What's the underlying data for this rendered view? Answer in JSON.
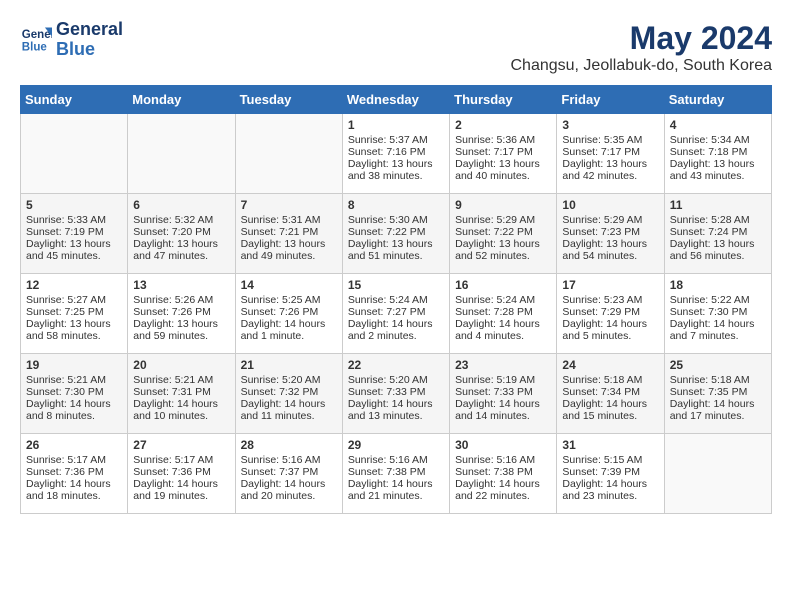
{
  "logo": {
    "line1": "General",
    "line2": "Blue"
  },
  "title": "May 2024",
  "location": "Changsu, Jeollabuk-do, South Korea",
  "days_of_week": [
    "Sunday",
    "Monday",
    "Tuesday",
    "Wednesday",
    "Thursday",
    "Friday",
    "Saturday"
  ],
  "weeks": [
    [
      {
        "day": "",
        "content": ""
      },
      {
        "day": "",
        "content": ""
      },
      {
        "day": "",
        "content": ""
      },
      {
        "day": "1",
        "content": "Sunrise: 5:37 AM\nSunset: 7:16 PM\nDaylight: 13 hours\nand 38 minutes."
      },
      {
        "day": "2",
        "content": "Sunrise: 5:36 AM\nSunset: 7:17 PM\nDaylight: 13 hours\nand 40 minutes."
      },
      {
        "day": "3",
        "content": "Sunrise: 5:35 AM\nSunset: 7:17 PM\nDaylight: 13 hours\nand 42 minutes."
      },
      {
        "day": "4",
        "content": "Sunrise: 5:34 AM\nSunset: 7:18 PM\nDaylight: 13 hours\nand 43 minutes."
      }
    ],
    [
      {
        "day": "5",
        "content": "Sunrise: 5:33 AM\nSunset: 7:19 PM\nDaylight: 13 hours\nand 45 minutes."
      },
      {
        "day": "6",
        "content": "Sunrise: 5:32 AM\nSunset: 7:20 PM\nDaylight: 13 hours\nand 47 minutes."
      },
      {
        "day": "7",
        "content": "Sunrise: 5:31 AM\nSunset: 7:21 PM\nDaylight: 13 hours\nand 49 minutes."
      },
      {
        "day": "8",
        "content": "Sunrise: 5:30 AM\nSunset: 7:22 PM\nDaylight: 13 hours\nand 51 minutes."
      },
      {
        "day": "9",
        "content": "Sunrise: 5:29 AM\nSunset: 7:22 PM\nDaylight: 13 hours\nand 52 minutes."
      },
      {
        "day": "10",
        "content": "Sunrise: 5:29 AM\nSunset: 7:23 PM\nDaylight: 13 hours\nand 54 minutes."
      },
      {
        "day": "11",
        "content": "Sunrise: 5:28 AM\nSunset: 7:24 PM\nDaylight: 13 hours\nand 56 minutes."
      }
    ],
    [
      {
        "day": "12",
        "content": "Sunrise: 5:27 AM\nSunset: 7:25 PM\nDaylight: 13 hours\nand 58 minutes."
      },
      {
        "day": "13",
        "content": "Sunrise: 5:26 AM\nSunset: 7:26 PM\nDaylight: 13 hours\nand 59 minutes."
      },
      {
        "day": "14",
        "content": "Sunrise: 5:25 AM\nSunset: 7:26 PM\nDaylight: 14 hours\nand 1 minute."
      },
      {
        "day": "15",
        "content": "Sunrise: 5:24 AM\nSunset: 7:27 PM\nDaylight: 14 hours\nand 2 minutes."
      },
      {
        "day": "16",
        "content": "Sunrise: 5:24 AM\nSunset: 7:28 PM\nDaylight: 14 hours\nand 4 minutes."
      },
      {
        "day": "17",
        "content": "Sunrise: 5:23 AM\nSunset: 7:29 PM\nDaylight: 14 hours\nand 5 minutes."
      },
      {
        "day": "18",
        "content": "Sunrise: 5:22 AM\nSunset: 7:30 PM\nDaylight: 14 hours\nand 7 minutes."
      }
    ],
    [
      {
        "day": "19",
        "content": "Sunrise: 5:21 AM\nSunset: 7:30 PM\nDaylight: 14 hours\nand 8 minutes."
      },
      {
        "day": "20",
        "content": "Sunrise: 5:21 AM\nSunset: 7:31 PM\nDaylight: 14 hours\nand 10 minutes."
      },
      {
        "day": "21",
        "content": "Sunrise: 5:20 AM\nSunset: 7:32 PM\nDaylight: 14 hours\nand 11 minutes."
      },
      {
        "day": "22",
        "content": "Sunrise: 5:20 AM\nSunset: 7:33 PM\nDaylight: 14 hours\nand 13 minutes."
      },
      {
        "day": "23",
        "content": "Sunrise: 5:19 AM\nSunset: 7:33 PM\nDaylight: 14 hours\nand 14 minutes."
      },
      {
        "day": "24",
        "content": "Sunrise: 5:18 AM\nSunset: 7:34 PM\nDaylight: 14 hours\nand 15 minutes."
      },
      {
        "day": "25",
        "content": "Sunrise: 5:18 AM\nSunset: 7:35 PM\nDaylight: 14 hours\nand 17 minutes."
      }
    ],
    [
      {
        "day": "26",
        "content": "Sunrise: 5:17 AM\nSunset: 7:36 PM\nDaylight: 14 hours\nand 18 minutes."
      },
      {
        "day": "27",
        "content": "Sunrise: 5:17 AM\nSunset: 7:36 PM\nDaylight: 14 hours\nand 19 minutes."
      },
      {
        "day": "28",
        "content": "Sunrise: 5:16 AM\nSunset: 7:37 PM\nDaylight: 14 hours\nand 20 minutes."
      },
      {
        "day": "29",
        "content": "Sunrise: 5:16 AM\nSunset: 7:38 PM\nDaylight: 14 hours\nand 21 minutes."
      },
      {
        "day": "30",
        "content": "Sunrise: 5:16 AM\nSunset: 7:38 PM\nDaylight: 14 hours\nand 22 minutes."
      },
      {
        "day": "31",
        "content": "Sunrise: 5:15 AM\nSunset: 7:39 PM\nDaylight: 14 hours\nand 23 minutes."
      },
      {
        "day": "",
        "content": ""
      }
    ]
  ]
}
